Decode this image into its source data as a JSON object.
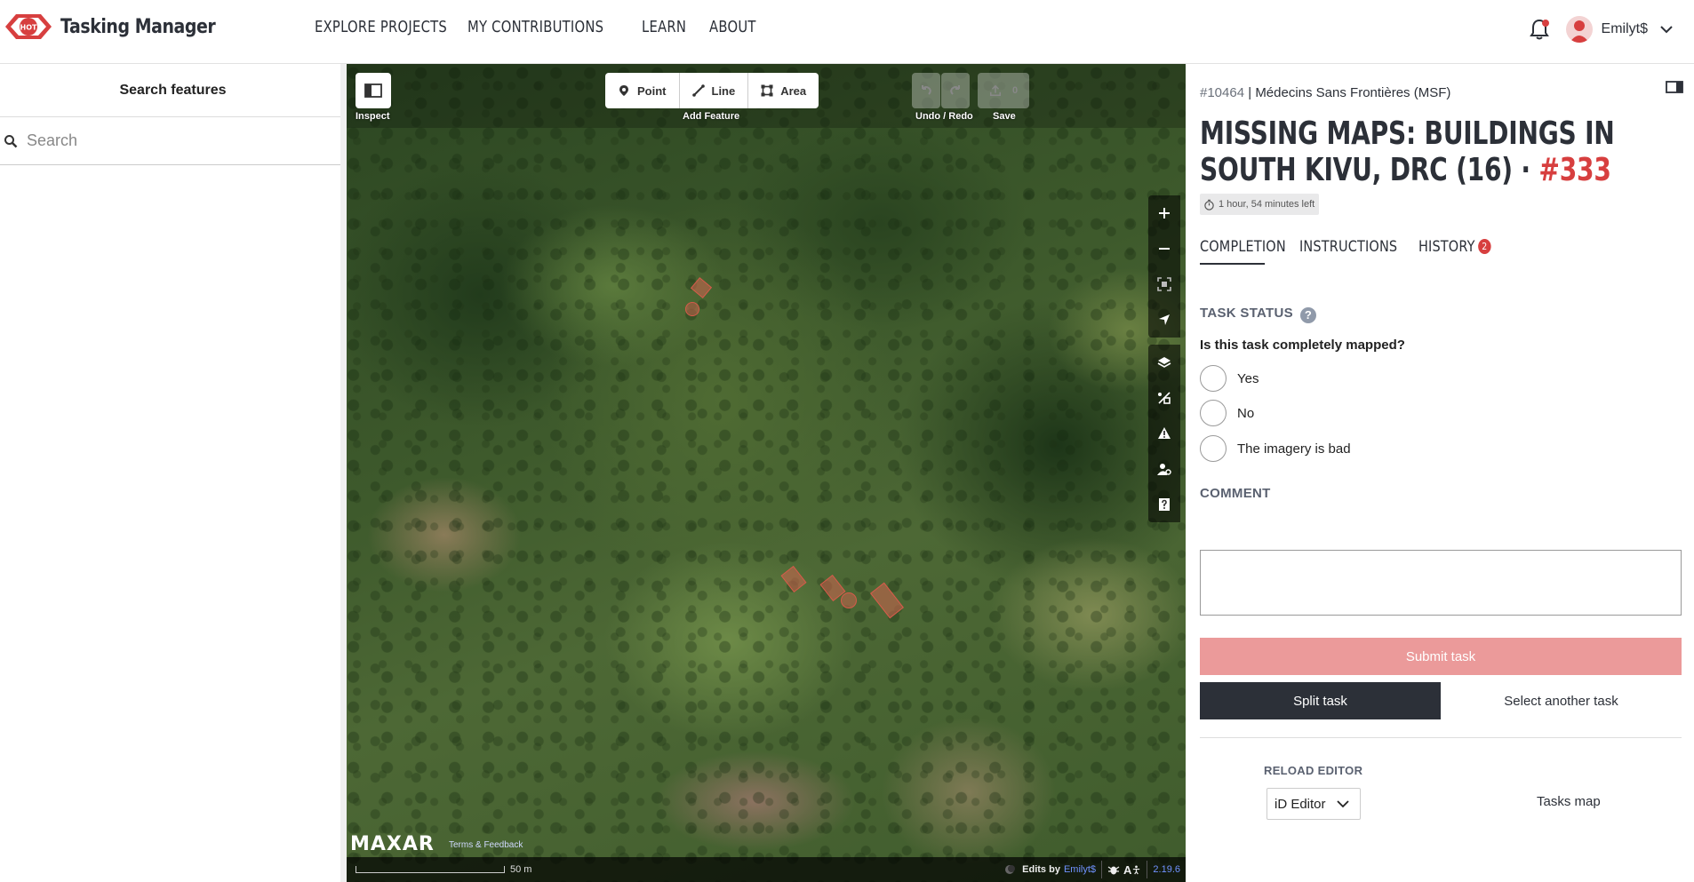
{
  "header": {
    "app_title": "Tasking Manager",
    "logo_badge": "HOT",
    "nav": [
      "EXPLORE PROJECTS",
      "MY CONTRIBUTIONS",
      "LEARN",
      "ABOUT"
    ],
    "username": "Emilyt$",
    "notification_dot_color": "#d73f3f"
  },
  "left_panel": {
    "title": "Search features",
    "search_placeholder": "Search"
  },
  "map_toolbar": {
    "inspect_label": "Inspect",
    "add_feature_label": "Add Feature",
    "point_label": "Point",
    "line_label": "Line",
    "area_label": "Area",
    "undo_redo_label": "Undo / Redo",
    "save_label": "Save",
    "save_count": "0",
    "side_tools": [
      "zoom-in-icon",
      "zoom-out-icon",
      "zoom-to-selection-icon",
      "geolocate-icon",
      "layers-icon",
      "map-data-icon",
      "issues-icon",
      "preferences-icon",
      "help-icon"
    ]
  },
  "map_footer": {
    "attribution_brand": "MAXAR",
    "terms_link": "Terms & Feedback",
    "scale_label": "50 m",
    "edits_by_prefix": "Edits by",
    "edits_by_user": "Emilyt$",
    "a11y_label": "A",
    "version": "2.19.6"
  },
  "task_panel": {
    "project_id": "#10464",
    "organisation": "Médecins Sans Frontières (MSF)",
    "project_title": "MISSING MAPS: BUILDINGS IN SOUTH KIVU, DRC (16)",
    "title_separator": "·",
    "task_number": "#333",
    "time_left": "1 hour, 54 minutes left",
    "tabs": [
      {
        "label": "COMPLETION",
        "active": true
      },
      {
        "label": "INSTRUCTIONS",
        "active": false
      },
      {
        "label": "HISTORY",
        "active": false,
        "badge": "2"
      }
    ],
    "task_status_heading": "TASK STATUS",
    "help_glyph": "?",
    "question": "Is this task completely mapped?",
    "options": [
      "Yes",
      "No",
      "The imagery is bad"
    ],
    "comment_heading": "COMMENT",
    "comment_value": "",
    "submit_label": "Submit task",
    "split_label": "Split task",
    "select_another_label": "Select another task",
    "reload_editor_label": "RELOAD EDITOR",
    "editor_selected": "iD Editor",
    "tasks_map_label": "Tasks map",
    "accent_color": "#d73f3f",
    "submit_disabled_color": "#eb9a9a"
  }
}
